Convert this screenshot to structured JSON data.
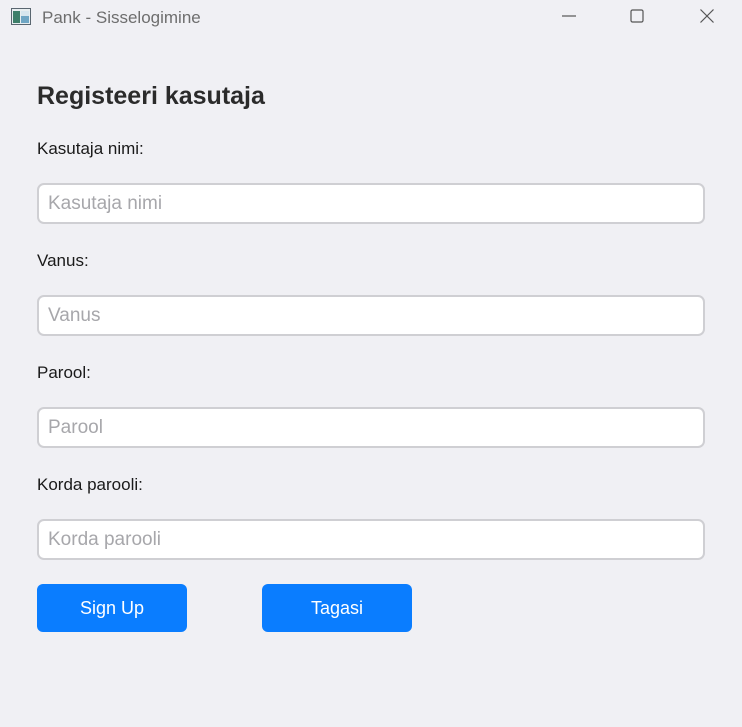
{
  "window": {
    "title": "Pank - Sisselogimine"
  },
  "form": {
    "heading": "Registeeri kasutaja",
    "fields": [
      {
        "label": "Kasutaja nimi:",
        "placeholder": "Kasutaja nimi",
        "value": ""
      },
      {
        "label": "Vanus:",
        "placeholder": "Vanus",
        "value": ""
      },
      {
        "label": "Parool:",
        "placeholder": "Parool",
        "value": ""
      },
      {
        "label": "Korda parooli:",
        "placeholder": "Korda parooli",
        "value": ""
      }
    ],
    "buttons": {
      "signup": "Sign Up",
      "back": "Tagasi"
    }
  },
  "colors": {
    "accent": "#0a7dff",
    "background": "#f0f0f4"
  },
  "icons": {
    "app": "app-window-icon",
    "minimize": "minimize-icon",
    "maximize": "maximize-icon",
    "close": "close-icon"
  }
}
